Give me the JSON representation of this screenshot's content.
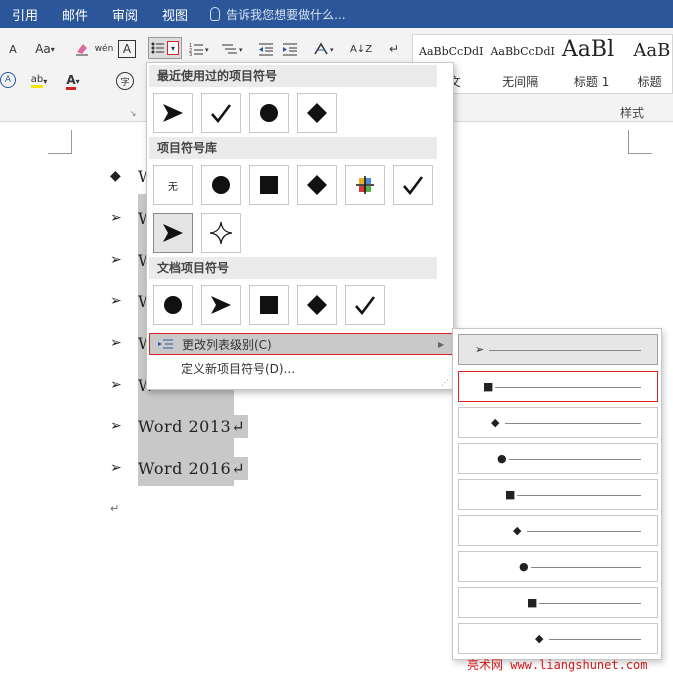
{
  "ribbon_tabs": [
    "引用",
    "邮件",
    "审阅",
    "视图"
  ],
  "tell_me": "告诉我您想要做什么...",
  "styles": [
    {
      "preview": "AaBbCcDdI",
      "label": "正文"
    },
    {
      "preview": "AaBbCcDdI",
      "label": "无间隔"
    },
    {
      "preview": "AaBl",
      "label": "标题 1"
    },
    {
      "preview": "AaB",
      "label": "标题"
    }
  ],
  "styles_group_label": "样式",
  "toolbar": {
    "font_size_up": "A",
    "font_case": "Aa",
    "phonetic": "wén",
    "char_border": "A",
    "sort": "A↓Z",
    "pilcrow": "↵",
    "highlight": "ab",
    "font_color": "A",
    "enclose": "字"
  },
  "gallery": {
    "recent_header": "最近使用过的项目符号",
    "library_header": "项目符号库",
    "doc_header": "文档项目符号",
    "none_label": "无",
    "recent": [
      "arrow-bullet",
      "check-bullet",
      "circle-bullet",
      "diamond-bullet"
    ],
    "library": [
      "none",
      "circle-bullet",
      "square-bullet",
      "diamond-bullet",
      "colored-plus-bullet",
      "check-bullet",
      "arrow-bullet",
      "star-bullet"
    ],
    "document": [
      "circle-bullet",
      "arrow-bullet",
      "square-bullet",
      "diamond-bullet",
      "check-bullet"
    ],
    "change_level": "更改列表级别(C)",
    "define_new": "定义新项目符号(D)..."
  },
  "document": {
    "list_items": [
      {
        "marker": "◆",
        "text": "W"
      },
      {
        "marker": "➢",
        "text": "W"
      },
      {
        "marker": "➢",
        "text": "W"
      },
      {
        "marker": "➢",
        "text": "W"
      },
      {
        "marker": "➢",
        "text": "W"
      },
      {
        "marker": "➢",
        "text": "W"
      },
      {
        "marker": "➢",
        "text": "Word 2013↵"
      },
      {
        "marker": "➢",
        "text": "Word 2016↵"
      }
    ],
    "trailing_para": "↵"
  },
  "levels": [
    {
      "symbol": "➢"
    },
    {
      "symbol": "■"
    },
    {
      "symbol": "◆"
    },
    {
      "symbol": "●"
    },
    {
      "symbol": "■"
    },
    {
      "symbol": "◆"
    },
    {
      "symbol": "●"
    },
    {
      "symbol": "■"
    },
    {
      "symbol": "◆"
    }
  ],
  "watermark": "亮术网 www.liangshunet.com",
  "colors": {
    "ribbon_blue": "#2b579a",
    "highlight_red": "#d22222",
    "selection_gray": "#c8c8c8"
  }
}
